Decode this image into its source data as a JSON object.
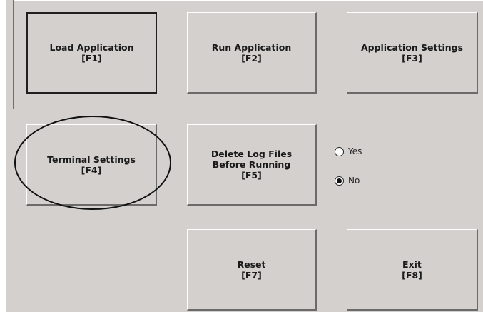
{
  "buttons": {
    "load_application": "Load Application\n[F1]",
    "run_application": "Run Application\n[F2]",
    "application_settings": "Application Settings\n[F3]",
    "terminal_settings": "Terminal Settings\n[F4]",
    "delete_log_files": "Delete Log Files\nBefore Running\n[F5]",
    "reset": "Reset\n[F7]",
    "exit": "Exit\n[F8]"
  },
  "delete_logs_option": {
    "yes_label": "Yes",
    "no_label": "No",
    "selected": "No"
  }
}
